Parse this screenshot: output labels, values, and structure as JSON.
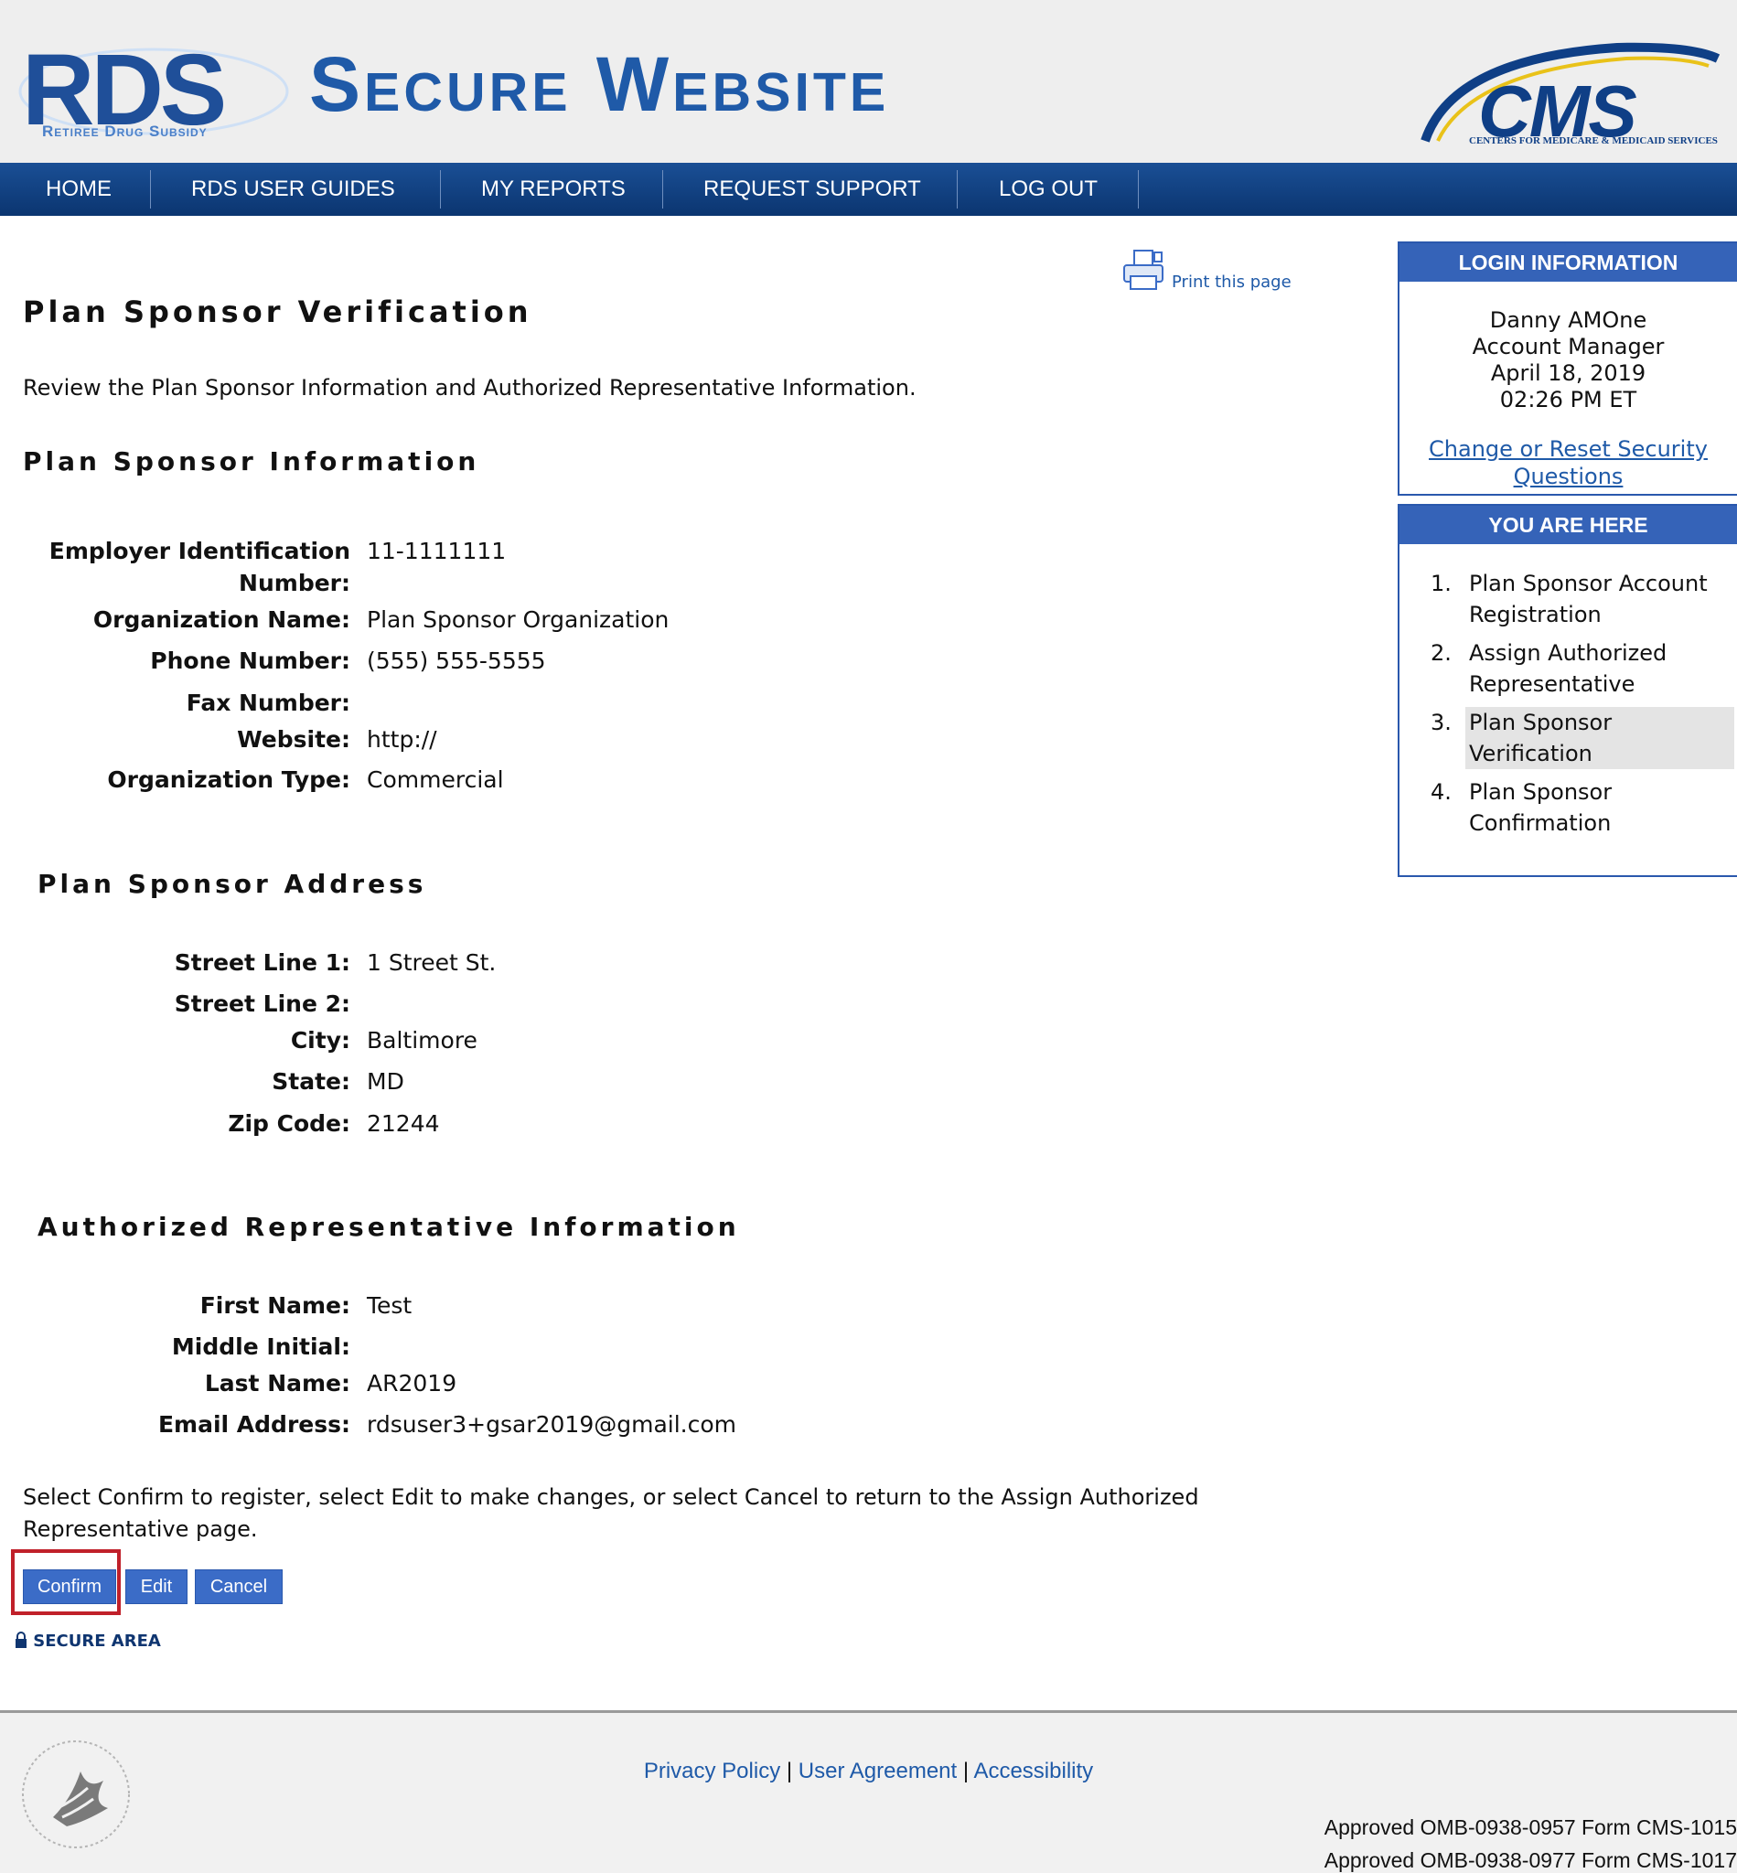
{
  "header": {
    "logo_text": "RDS",
    "logo_subtitle": "Retiree Drug Subsidy",
    "site_title": "Secure Website",
    "cms_text": "CMS",
    "cms_subtitle": "CENTERS FOR MEDICARE & MEDICAID SERVICES"
  },
  "nav": {
    "items": [
      {
        "label": "HOME"
      },
      {
        "label": "RDS USER GUIDES"
      },
      {
        "label": "MY REPORTS"
      },
      {
        "label": "REQUEST SUPPORT"
      },
      {
        "label": "LOG OUT"
      }
    ]
  },
  "print": {
    "label": "Print this page",
    "icon": "printer-icon"
  },
  "page": {
    "title": "Plan Sponsor Verification",
    "intro": "Review the Plan Sponsor Information and Authorized Representative Information."
  },
  "plan_sponsor_info": {
    "heading": "Plan Sponsor Information",
    "fields": [
      {
        "label_line1": "Employer Identification",
        "label_line2": "Number:",
        "value": "11-1111111"
      },
      {
        "label": "Organization Name:",
        "value": "Plan Sponsor Organization"
      },
      {
        "label": "Phone Number:",
        "value": "(555) 555-5555"
      },
      {
        "label": "Fax Number:",
        "value": ""
      },
      {
        "label": "Website:",
        "value": "http://"
      },
      {
        "label": "Organization Type:",
        "value": "Commercial"
      }
    ]
  },
  "plan_sponsor_address": {
    "heading": "Plan Sponsor Address",
    "fields": [
      {
        "label": "Street Line 1:",
        "value": "1 Street St."
      },
      {
        "label": "Street Line 2:",
        "value": ""
      },
      {
        "label": "City:",
        "value": "Baltimore"
      },
      {
        "label": "State:",
        "value": "MD"
      },
      {
        "label": "Zip Code:",
        "value": "21244"
      }
    ]
  },
  "authorized_rep": {
    "heading": "Authorized Representative Information",
    "fields": [
      {
        "label": "First Name:",
        "value": "Test"
      },
      {
        "label": "Middle Initial:",
        "value": ""
      },
      {
        "label": "Last Name:",
        "value": "AR2019"
      },
      {
        "label": "Email Address:",
        "value": "rdsuser3+gsar2019@gmail.com"
      }
    ]
  },
  "instructions": "Select Confirm to register, select Edit to make changes, or select Cancel to return to the Assign Authorized Representative page.",
  "buttons": {
    "confirm": "Confirm",
    "edit": "Edit",
    "cancel": "Cancel"
  },
  "secure_area": {
    "label": "SECURE AREA",
    "icon": "lock-icon"
  },
  "login_info": {
    "heading": "LOGIN INFORMATION",
    "name": "Danny AMOne",
    "role": "Account Manager",
    "date": "April 18, 2019",
    "time": "02:26 PM ET",
    "link": "Change or Reset Security Questions"
  },
  "you_are_here": {
    "heading": "YOU ARE HERE",
    "steps": [
      {
        "num": "1.",
        "label": "Plan Sponsor Account Registration"
      },
      {
        "num": "2.",
        "label": "Assign Authorized Representative"
      },
      {
        "num": "3.",
        "label": "Plan Sponsor Verification"
      },
      {
        "num": "4.",
        "label": "Plan Sponsor Confirmation"
      }
    ]
  },
  "footer": {
    "links": {
      "privacy": "Privacy Policy",
      "agreement": "User Agreement",
      "accessibility": "Accessibility"
    },
    "separator": "|",
    "omb_lines": [
      "Approved OMB-0938-0957 Form CMS-1015",
      "Approved OMB-0938-0977 Form CMS-1017"
    ],
    "seal_icon": "hhs-seal-icon"
  },
  "colors": {
    "nav_blue": "#0b3570",
    "accent_blue": "#3563b8",
    "button_blue": "#3b6cc7",
    "link_blue": "#1f5aa8",
    "highlight_red": "#c0202a"
  }
}
